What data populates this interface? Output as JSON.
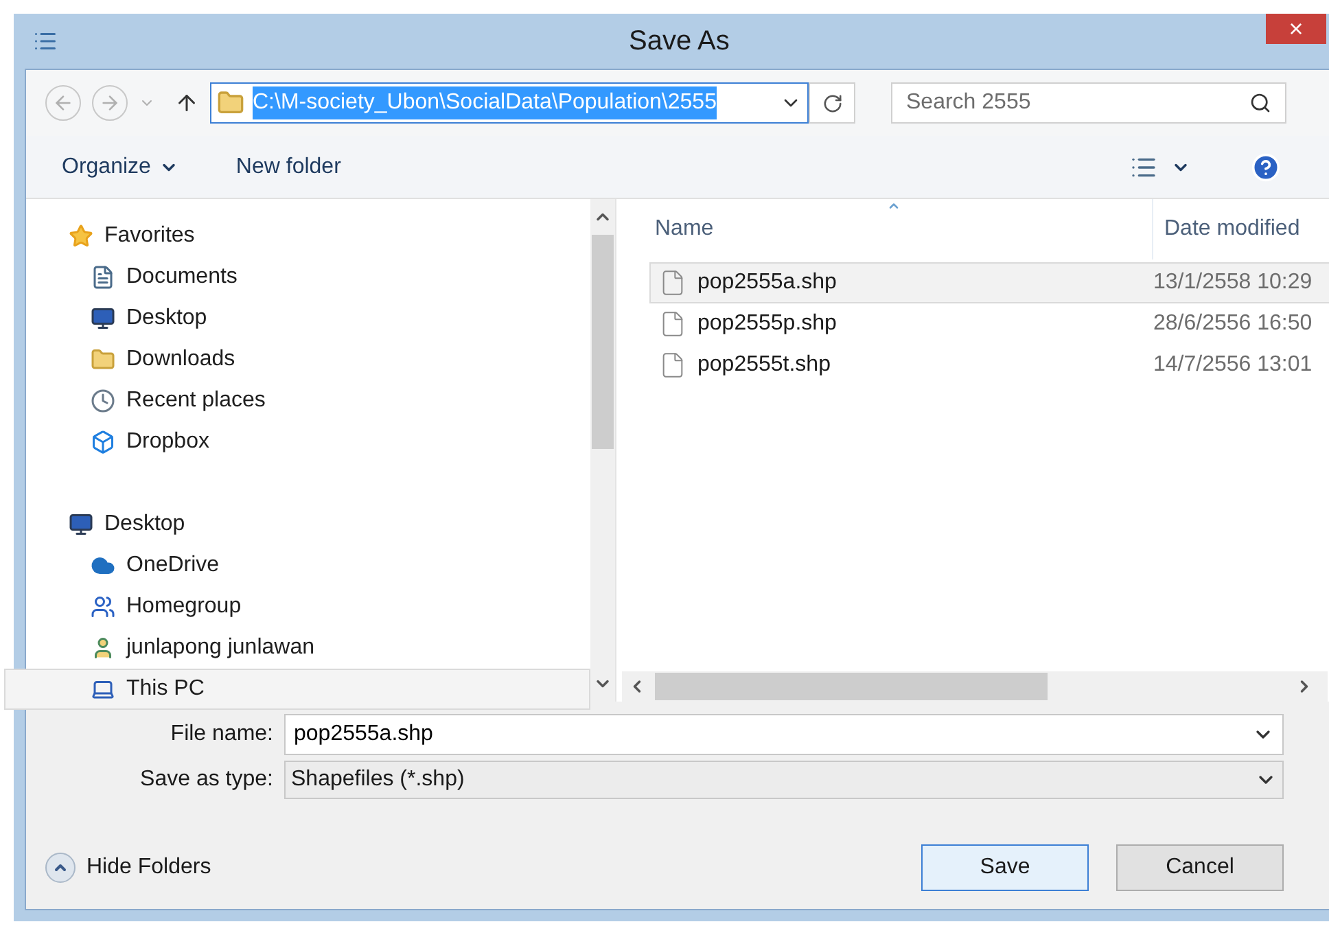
{
  "window": {
    "title": "Save As",
    "close": "×"
  },
  "address_bar": {
    "path": "C:\\M-society_Ubon\\SocialData\\Population\\2555"
  },
  "search": {
    "placeholder": "Search 2555"
  },
  "toolbar": {
    "organize": "Organize",
    "new_folder": "New folder"
  },
  "sidebar": {
    "groups": [
      {
        "label": "Favorites",
        "kind": "star",
        "selected": false,
        "children": [
          {
            "label": "Documents",
            "kind": "document",
            "selected": false
          },
          {
            "label": "Desktop",
            "kind": "monitor",
            "selected": false
          },
          {
            "label": "Downloads",
            "kind": "download-folder",
            "selected": false
          },
          {
            "label": "Recent places",
            "kind": "recent",
            "selected": false
          },
          {
            "label": "Dropbox",
            "kind": "dropbox",
            "selected": false
          }
        ]
      },
      {
        "label": "Desktop",
        "kind": "monitor",
        "selected": false,
        "children": [
          {
            "label": "OneDrive",
            "kind": "cloud",
            "selected": false
          },
          {
            "label": "Homegroup",
            "kind": "network",
            "selected": false
          },
          {
            "label": "junlapong junlawan",
            "kind": "user-folder",
            "selected": false
          },
          {
            "label": "This PC",
            "kind": "computer",
            "selected": true
          }
        ]
      }
    ]
  },
  "file_list": {
    "columns": [
      "Name",
      "Date modified"
    ],
    "rows": [
      {
        "name": "pop2555a.shp",
        "date": "13/1/2558 10:29",
        "selected": true
      },
      {
        "name": "pop2555p.shp",
        "date": "28/6/2556 16:50",
        "selected": false
      },
      {
        "name": "pop2555t.shp",
        "date": "14/7/2556 13:01",
        "selected": false
      }
    ]
  },
  "form": {
    "file_name_label": "File name:",
    "file_name": "pop2555a.shp",
    "type_label": "Save as type:",
    "type_value": "Shapefiles (*.shp)"
  },
  "footer": {
    "hide_folders": "Hide Folders",
    "buttons": [
      {
        "label": "Save",
        "kind": "default"
      },
      {
        "label": "Cancel",
        "kind": "normal"
      }
    ]
  }
}
